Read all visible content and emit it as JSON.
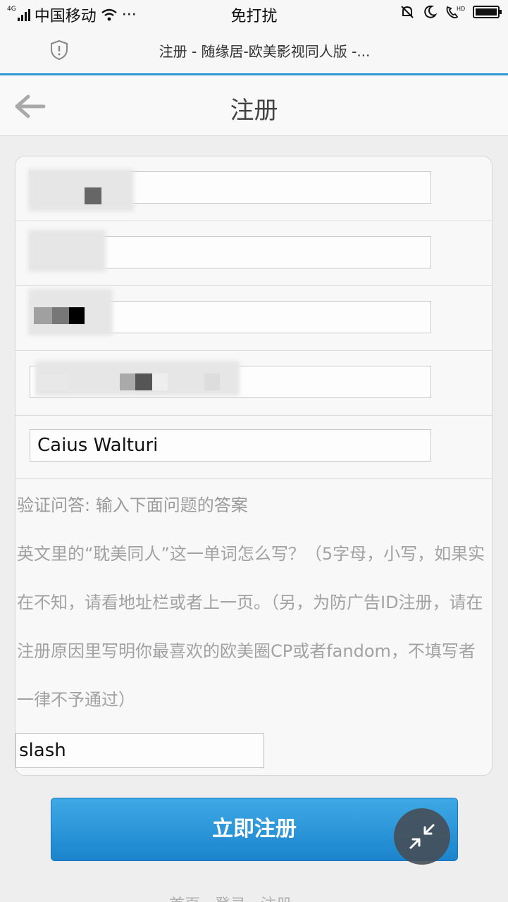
{
  "status_bar": {
    "network": "4G",
    "carrier": "中国移动",
    "more": "···",
    "mode": "免打扰"
  },
  "browser": {
    "page_title": "注册 - 随缘居-欧美影视同人版 -..."
  },
  "header": {
    "title": "注册"
  },
  "form": {
    "fields": [
      {
        "value": ""
      },
      {
        "value": ""
      },
      {
        "value": ""
      },
      {
        "value": ""
      },
      {
        "value": "Caius Walturi"
      }
    ],
    "verify_label": "验证问答: 输入下面问题的答案",
    "question": "英文里的“耽美同人”这一单词怎么写？（5字母，小写，如果实在不知，请看地址栏或者上一页。（另，为防广告ID注册，请在注册原因里写明你最喜欢的欧美圈CP或者fandom，不填写者一律不予通过）",
    "answer": "slash"
  },
  "register_button": {
    "label": "立即注册"
  },
  "footer": {
    "links": "首页 · 登录 · 注册"
  },
  "colors": {
    "accent": "#2f9bd6",
    "button": "#2a93d8"
  },
  "icons": {
    "back": "arrow-left-icon",
    "shield": "shield-icon",
    "fab": "collapse-icon"
  }
}
